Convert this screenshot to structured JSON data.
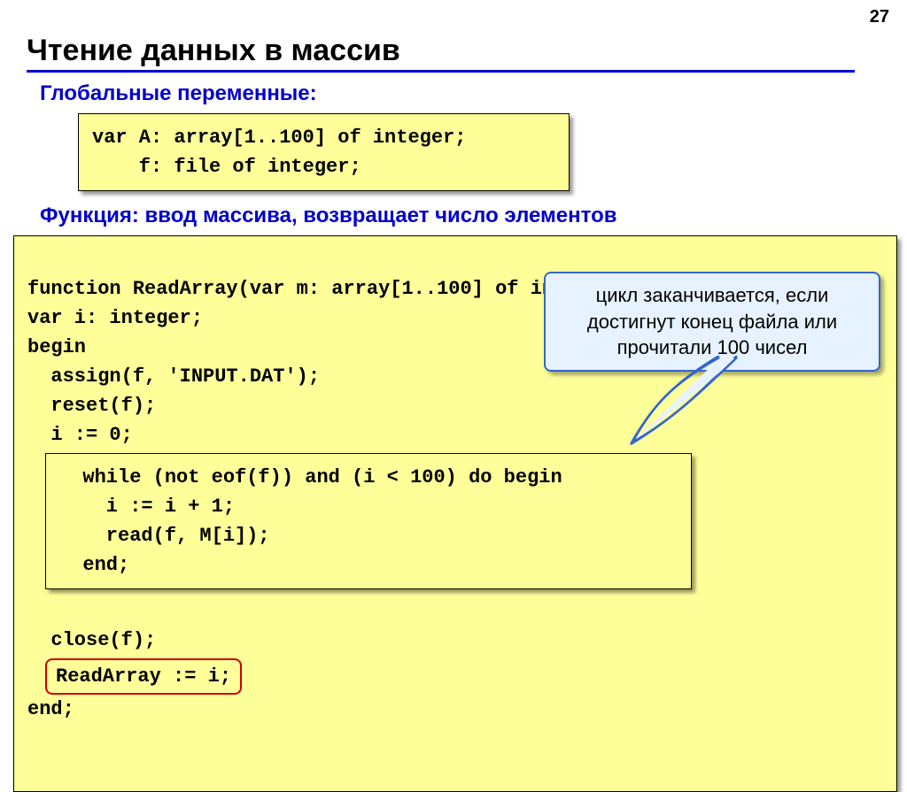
{
  "page_number": "27",
  "title": "Чтение данных в массив",
  "section1": {
    "heading": "Глобальные переменные:",
    "code": "var A: array[1..100] of integer;\n    f: file of integer;"
  },
  "section2": {
    "heading": "Функция: ввод массива, возвращает число элементов",
    "code_pre": "function ReadArray(var m: array[1..100] of integer):integer;\nvar i: integer;\nbegin\n  assign(f, 'INPUT.DAT');\n  reset(f);\n  i := 0;",
    "code_inner": "  while (not eof(f)) and (i < 100) do begin\n    i := i + 1;\n    read(f, M[i]);\n  end;",
    "code_post1": "  close(f);",
    "highlight": "ReadArray := i;",
    "code_post2": "end;",
    "callout": "цикл заканчивается, если достигнут конец файла или прочитали 100 чисел"
  }
}
